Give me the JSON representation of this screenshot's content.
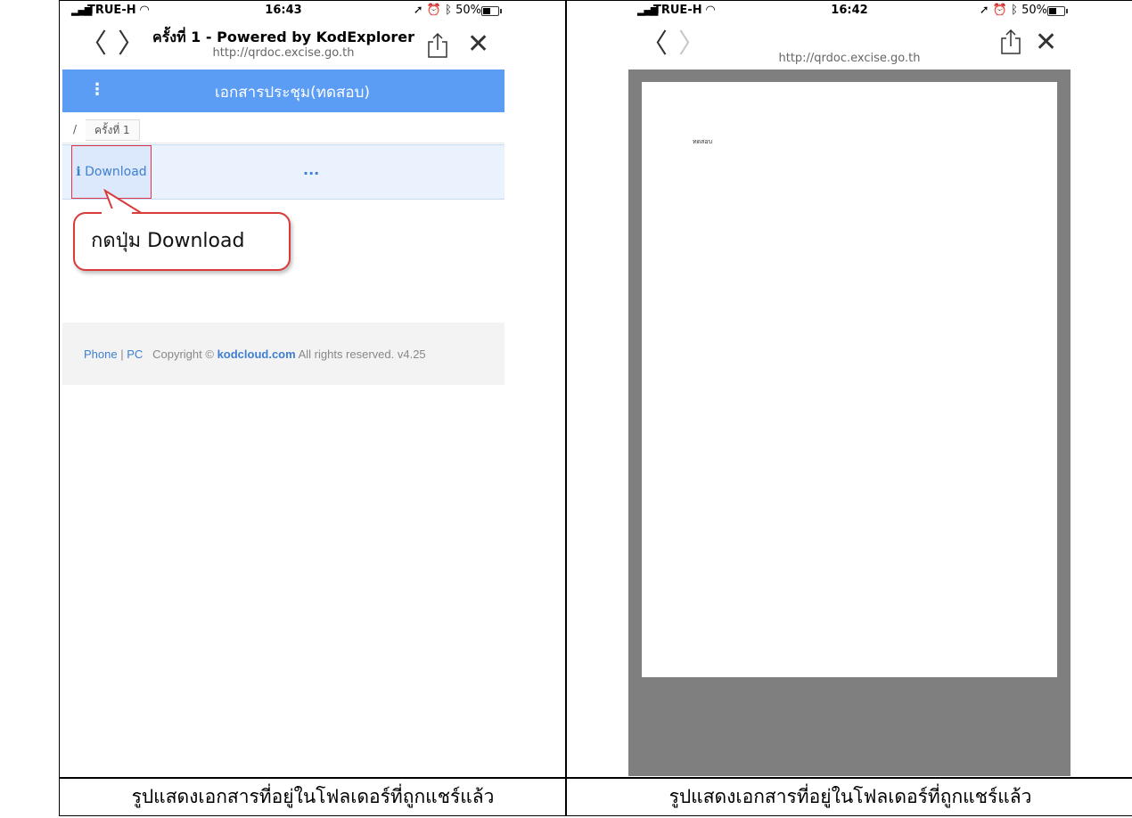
{
  "left_phone": {
    "status": {
      "carrier": "TRUE-H",
      "time": "16:43",
      "battery": "50%"
    },
    "nav": {
      "back_glyph": "〈",
      "forward_glyph": "〉",
      "title": "ครั้งที่ 1 - Powered by KodExplorer",
      "url": "http://qrdoc.excise.go.th",
      "close_glyph": "✕"
    },
    "appbar": {
      "menu_glyph": "⋮",
      "title": "เอกสารประชุม(ทดสอบ)"
    },
    "breadcrumb": {
      "root": "/",
      "item": "ครั้งที่ 1"
    },
    "toolbar": {
      "info_glyph": "i",
      "download_label": "Download",
      "more_label": "..."
    },
    "callout": "กดปุ่ม Download",
    "footer": {
      "phone": "Phone",
      "sep1": " | ",
      "pc": "PC",
      "copyright": "Copyright ©",
      "brand": "kodcloud.com",
      "rest": "All rights reserved. v4.25"
    }
  },
  "right_phone": {
    "status": {
      "carrier": "TRUE-H",
      "time": "16:42",
      "battery": "50%"
    },
    "nav": {
      "back_glyph": "〈",
      "forward_glyph": "〉",
      "url": "http://qrdoc.excise.go.th",
      "close_glyph": "✕"
    },
    "document_text": "ทดสอบ"
  },
  "captions": {
    "left": "รูปแสดงเอกสารที่อยู่ในโฟลเดอร์ที่ถูกแชร์แล้ว",
    "right": "รูปแสดงเอกสารที่อยู่ในโฟลเดอร์ที่ถูกแชร์แล้ว"
  },
  "colors": {
    "appbar": "#5b9cf4",
    "link": "#3f7fd1",
    "highlight": "#e0344a",
    "viewer_bg": "#7f7f7f"
  },
  "icons": {
    "share": "share-icon",
    "close": "close-icon",
    "wifi": "wifi-icon",
    "location": "location-arrow-icon",
    "alarm": "alarm-icon",
    "bluetooth": "bluetooth-icon"
  }
}
